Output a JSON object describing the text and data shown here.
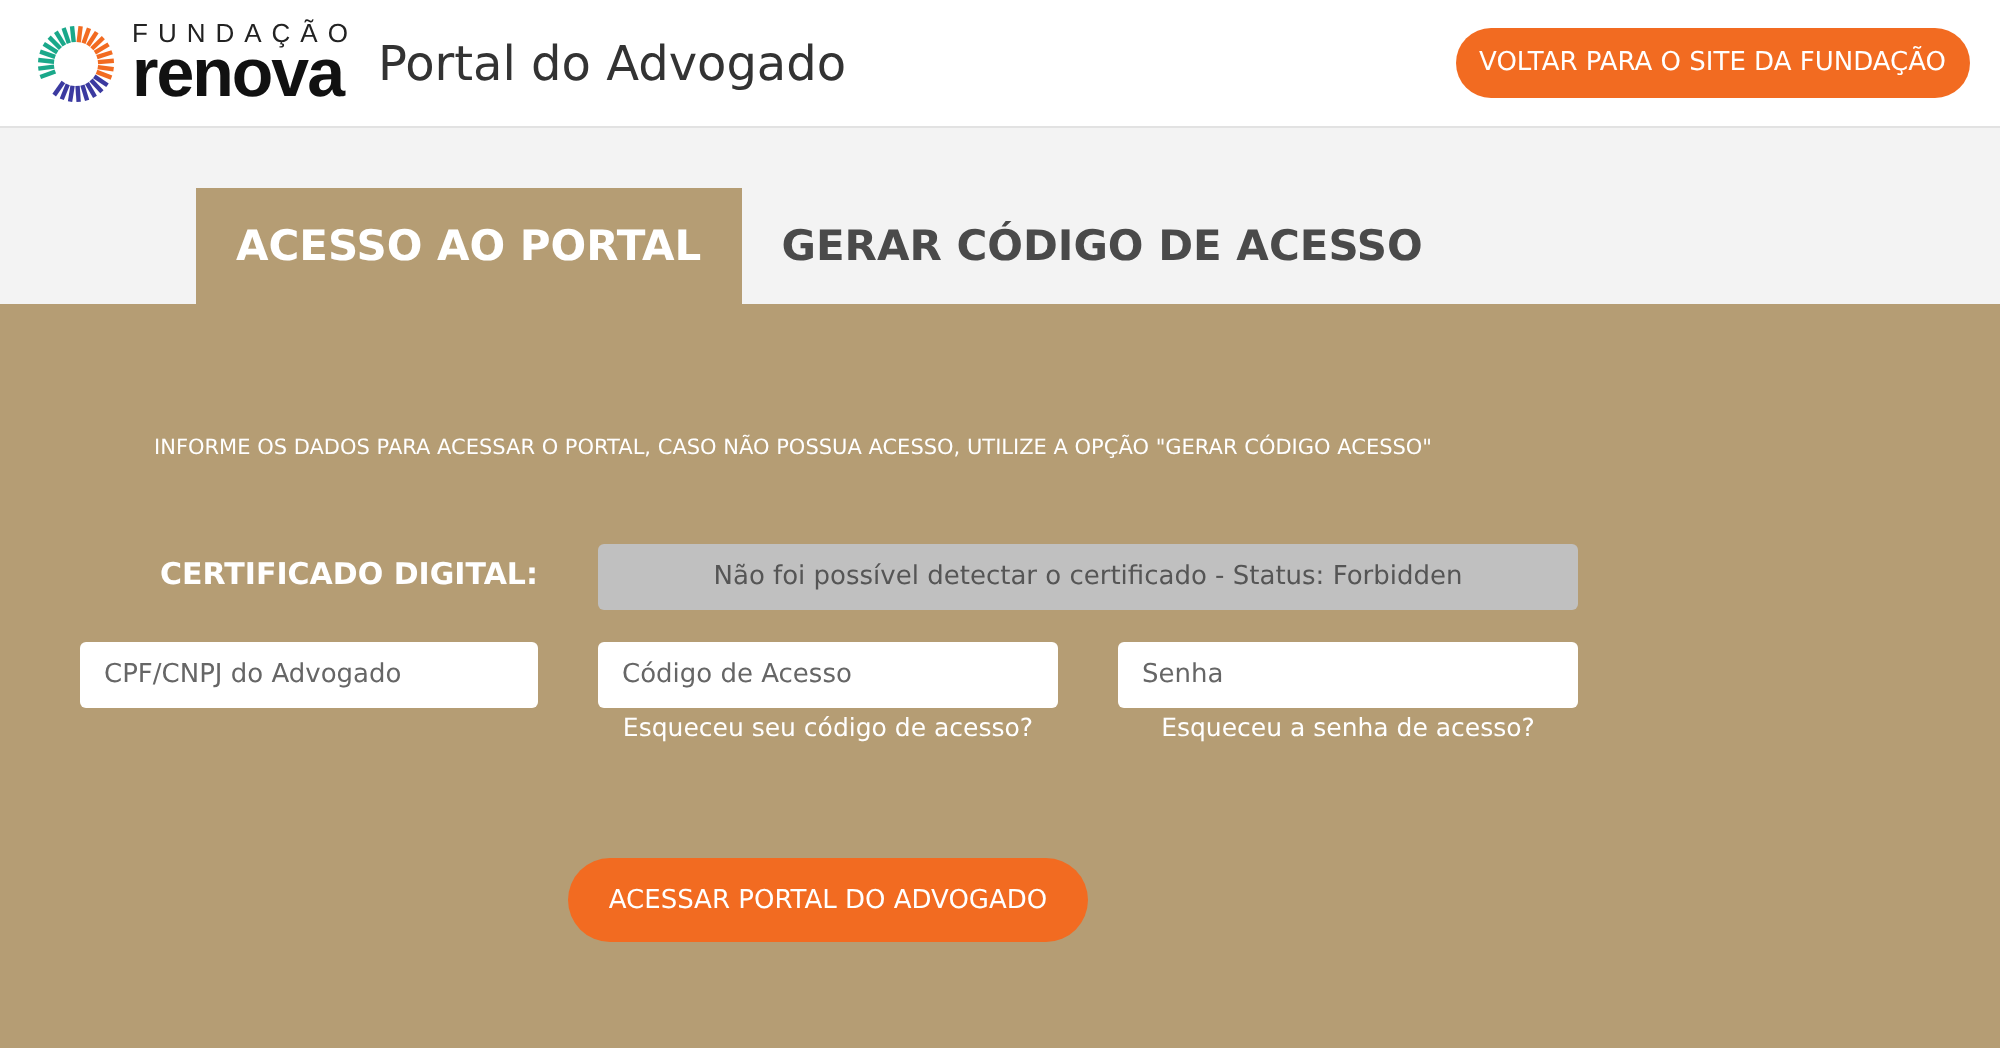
{
  "header": {
    "logo_top": "FUNDAÇÃO",
    "logo_main": "renova",
    "title": "Portal do Advogado",
    "back_button": "VOLTAR PARA O SITE DA FUNDAÇÃO"
  },
  "tabs": [
    {
      "label": "ACESSO AO PORTAL",
      "selected": true
    },
    {
      "label": "GERAR CÓDIGO DE ACESSO",
      "selected": false
    }
  ],
  "form": {
    "instructions": "INFORME OS DADOS PARA ACESSAR O PORTAL, CASO NÃO POSSUA ACESSO, UTILIZE A OPÇÃO \"GERAR CÓDIGO ACESSO\"",
    "certificate_label": "CERTIFICADO DIGITAL:",
    "certificate_status": "Não foi possível detectar o certificado - Status: Forbidden",
    "fields": [
      {
        "placeholder": "CPF/CNPJ do Advogado"
      },
      {
        "placeholder": "Código de Acesso",
        "link": "Esqueceu seu código de acesso?"
      },
      {
        "placeholder": "Senha",
        "link": "Esqueceu a senha de acesso?"
      }
    ],
    "submit": "ACESSAR PORTAL DO ADVOGADO"
  }
}
